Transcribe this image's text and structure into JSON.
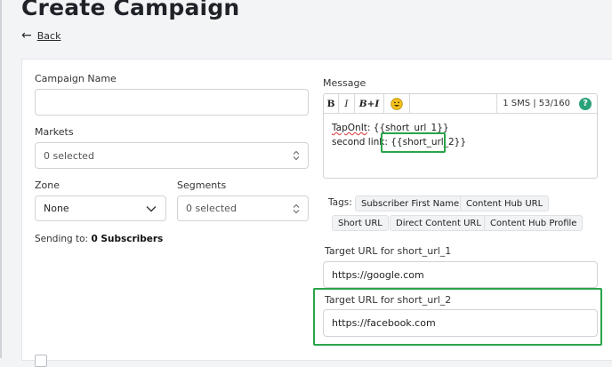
{
  "header": {
    "title": "Create Campaign",
    "back_label": "Back"
  },
  "form": {
    "campaign_name": {
      "label": "Campaign Name",
      "value": ""
    },
    "markets": {
      "label": "Markets",
      "value": "0 selected"
    },
    "zone": {
      "label": "Zone",
      "value": "None"
    },
    "segments": {
      "label": "Segments",
      "value": "0 selected"
    },
    "sending_to": {
      "label": "Sending to:",
      "value": "0 Subscribers"
    }
  },
  "message": {
    "label": "Message",
    "toolbar": {
      "bold": "B",
      "italic": "I",
      "bold_italic": "B+I",
      "emoji": "emoji-icon",
      "sms_count": "1 SMS | 53/160",
      "help": "?"
    },
    "line1_prefix": "TapOnIt",
    "line1_rest": ": {{short_url_1}}",
    "line2_prefix": "second link: ",
    "line2_token": "{{short_url_2}}"
  },
  "tags": {
    "label": "Tags:",
    "items": [
      "Subscriber First Name",
      "Content Hub URL",
      "Short URL",
      "Direct Content URL",
      "Content Hub Profile"
    ]
  },
  "target_urls": [
    {
      "label": "Target URL for short_url_1",
      "value": "https://google.com"
    },
    {
      "label": "Target URL for short_url_2",
      "value": "https://facebook.com"
    }
  ],
  "colors": {
    "accent_green": "#2aa44a",
    "help_green": "#2aa27a"
  }
}
